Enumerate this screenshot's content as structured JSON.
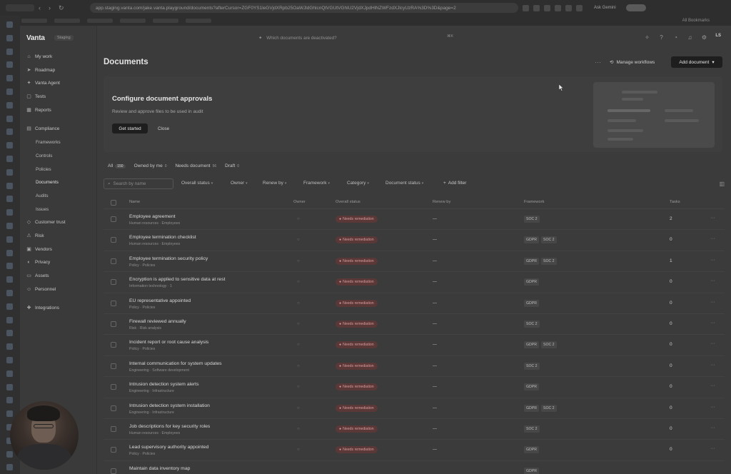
{
  "browser": {
    "url": "app.staging.vanta.com/jake.vanta.playground/documents?afterCursor=ZGF0YS1leGVjdXRpb25OaWJldGhlcnQtVGUtVGhlU2VjdXJpdHlNZWFzdXJlcyUzRA%3D%3D&page=2",
    "ask_label": "Ask Gemini",
    "all_bookmarks": "All Bookmarks"
  },
  "sidebar": {
    "logo": "Vanta",
    "env_badge": "Staging",
    "items": [
      {
        "label": "My work",
        "icon": "home-icon"
      },
      {
        "label": "Roadmap",
        "icon": "roadmap-icon"
      },
      {
        "label": "Vanta Agent",
        "icon": "agent-icon"
      },
      {
        "label": "Tests",
        "icon": "tests-icon"
      },
      {
        "label": "Reports",
        "icon": "reports-icon"
      }
    ],
    "compliance": {
      "label": "Compliance",
      "icon": "compliance-icon"
    },
    "compliance_sub": [
      "Frameworks",
      "Controls",
      "Policies",
      "Documents",
      "Audits",
      "Issues"
    ],
    "items2": [
      {
        "label": "Customer trust",
        "icon": "trust-icon"
      },
      {
        "label": "Risk",
        "icon": "risk-icon"
      },
      {
        "label": "Vendors",
        "icon": "vendors-icon"
      },
      {
        "label": "Privacy",
        "icon": "privacy-icon"
      },
      {
        "label": "Assets",
        "icon": "assets-icon"
      },
      {
        "label": "Personnel",
        "icon": "personnel-icon"
      }
    ],
    "integrations": {
      "label": "Integrations",
      "icon": "integrations-icon"
    }
  },
  "topbar": {
    "search_placeholder": "Which documents are deactivated?",
    "shortcut": "⌘K",
    "user_initials": "LS"
  },
  "page": {
    "title": "Documents",
    "manage_workflows": "Manage workflows",
    "add_document": "Add document"
  },
  "banner": {
    "title": "Configure document approvals",
    "subtitle": "Review and approve files to be used in audit",
    "get_started": "Get started",
    "close": "Close"
  },
  "filter_tabs": [
    {
      "label": "All",
      "count": "150"
    },
    {
      "label": "Owned by me",
      "count": "0"
    },
    {
      "label": "Needs document",
      "count": "56"
    },
    {
      "label": "Draft",
      "count": "0"
    }
  ],
  "filters": {
    "search_placeholder": "Search by name",
    "dropdowns": [
      "Overall status",
      "Owner",
      "Renew by",
      "Framework",
      "Category",
      "Document status"
    ],
    "add_filter": "Add filter"
  },
  "table": {
    "columns": [
      "Name",
      "Owner",
      "Overall status",
      "Renew by",
      "Framework",
      "Tasks"
    ],
    "rows": [
      {
        "name": "Employee agreement",
        "meta": "Human resources · Employees",
        "status": "Needs remediation",
        "renew": "—",
        "frameworks": [
          "SOC 2"
        ],
        "tasks": "2"
      },
      {
        "name": "Employee termination checklist",
        "meta": "Human resources · Employees",
        "status": "Needs remediation",
        "renew": "—",
        "frameworks": [
          "GDPR",
          "SOC 2"
        ],
        "tasks": "0"
      },
      {
        "name": "Employee termination security policy",
        "meta": "Policy · Policies",
        "status": "Needs remediation",
        "renew": "—",
        "frameworks": [
          "GDPR",
          "SOC 2"
        ],
        "tasks": "1"
      },
      {
        "name": "Encryption is applied to sensitive data at rest",
        "meta": "Information technology · 1",
        "status": "Needs remediation",
        "renew": "—",
        "frameworks": [
          "GDPR"
        ],
        "tasks": "0"
      },
      {
        "name": "EU representative appointed",
        "meta": "Policy · Policies",
        "status": "Needs remediation",
        "renew": "—",
        "frameworks": [
          "GDPR"
        ],
        "tasks": "0"
      },
      {
        "name": "Firewall reviewed annually",
        "meta": "Risk · Risk analysis",
        "status": "Needs remediation",
        "renew": "—",
        "frameworks": [
          "SOC 2"
        ],
        "tasks": "0"
      },
      {
        "name": "Incident report or root cause analysis",
        "meta": "Policy · Policies",
        "status": "Needs remediation",
        "renew": "—",
        "frameworks": [
          "GDPR",
          "SOC 2"
        ],
        "tasks": "0"
      },
      {
        "name": "Internal communication for system updates",
        "meta": "Engineering · Software development",
        "status": "Needs remediation",
        "renew": "—",
        "frameworks": [
          "SOC 2"
        ],
        "tasks": "0"
      },
      {
        "name": "Intrusion detection system alerts",
        "meta": "Engineering · Infrastructure",
        "status": "Needs remediation",
        "renew": "—",
        "frameworks": [
          "GDPR"
        ],
        "tasks": "0"
      },
      {
        "name": "Intrusion detection system installation",
        "meta": "Engineering · Infrastructure",
        "status": "Needs remediation",
        "renew": "—",
        "frameworks": [
          "GDPR",
          "SOC 2"
        ],
        "tasks": "0"
      },
      {
        "name": "Job descriptions for key security roles",
        "meta": "Human resources · Employees",
        "status": "Needs remediation",
        "renew": "—",
        "frameworks": [
          "SOC 2"
        ],
        "tasks": "0"
      },
      {
        "name": "Lead supervisory authority appointed",
        "meta": "Policy · Policies",
        "status": "Needs remediation",
        "renew": "—",
        "frameworks": [
          "GDPR"
        ],
        "tasks": "0"
      },
      {
        "name": "Maintain data inventory map",
        "meta": "",
        "status": "",
        "renew": "",
        "frameworks": [
          "GDPR"
        ],
        "tasks": ""
      }
    ]
  },
  "colors": {
    "overlay_bg": "#3b3b3b",
    "status_pill": "#5a3838",
    "primary_button": "#1e1e1e"
  }
}
